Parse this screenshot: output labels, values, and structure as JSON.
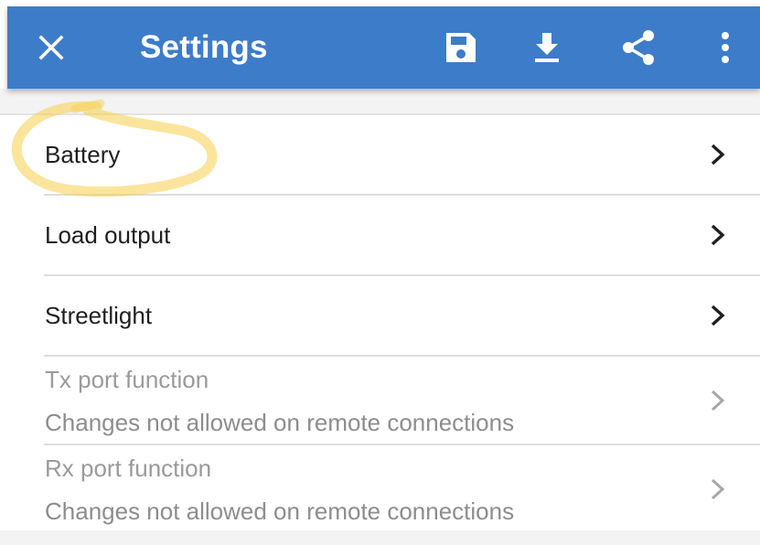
{
  "app_bar": {
    "title": "Settings",
    "background": "#3d7cc9",
    "icons": [
      "close-icon",
      "save-icon",
      "download-icon",
      "share-icon",
      "more-vert-icon"
    ]
  },
  "settings": {
    "items": [
      {
        "label": "Battery",
        "enabled": true
      },
      {
        "label": "Load output",
        "enabled": true
      },
      {
        "label": "Streetlight",
        "enabled": true
      },
      {
        "label": "Tx port function",
        "subtitle": "Changes not allowed on remote connections",
        "enabled": false
      },
      {
        "label": "Rx port function",
        "subtitle": "Changes not allowed on remote connections",
        "enabled": false
      }
    ]
  },
  "colors": {
    "accent": "#3d7cc9",
    "highlight_marker": "#f7d04a",
    "disabled_text": "#9a9a9a"
  }
}
